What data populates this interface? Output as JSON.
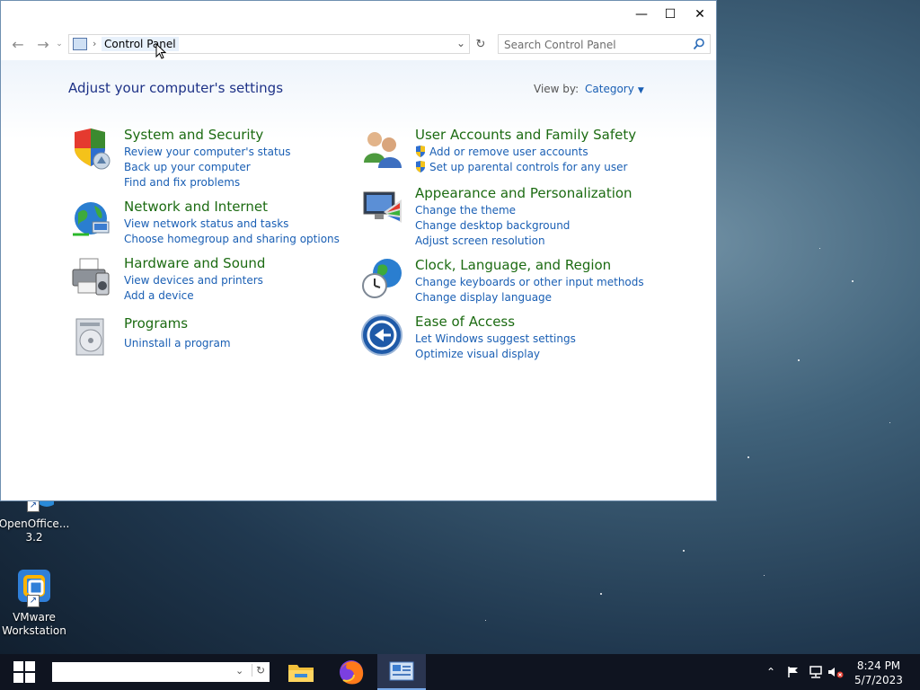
{
  "window": {
    "minimize_glyph": "—",
    "maximize_glyph": "☐",
    "close_glyph": "✕"
  },
  "address": {
    "crumb": "Control Panel",
    "separator": "›"
  },
  "search": {
    "placeholder": "Search Control Panel"
  },
  "header": {
    "title": "Adjust your computer's settings",
    "view_by_label": "View by:",
    "view_by_value": "Category"
  },
  "categories": [
    {
      "title": "System and Security",
      "icon": "shield-icon",
      "links": [
        "Review your computer's status",
        "Back up your computer",
        "Find and fix problems"
      ]
    },
    {
      "title": "Network and Internet",
      "icon": "network-globe-icon",
      "links": [
        "View network status and tasks",
        "Choose homegroup and sharing options"
      ]
    },
    {
      "title": "Hardware and Sound",
      "icon": "printer-icon",
      "links": [
        "View devices and printers",
        "Add a device"
      ]
    },
    {
      "title": "Programs",
      "icon": "programs-disc-icon",
      "links": [
        "Uninstall a program"
      ]
    },
    {
      "title": "User Accounts and Family Safety",
      "icon": "users-icon",
      "links": [
        "Add or remove user accounts",
        "Set up parental controls for any user"
      ]
    },
    {
      "title": "Appearance and Personalization",
      "icon": "monitor-palette-icon",
      "links": [
        "Change the theme",
        "Change desktop background",
        "Adjust screen resolution"
      ]
    },
    {
      "title": "Clock, Language, and Region",
      "icon": "clock-globe-icon",
      "links": [
        "Change keyboards or other input methods",
        "Change display language"
      ]
    },
    {
      "title": "Ease of Access",
      "icon": "ease-of-access-icon",
      "links": [
        "Let Windows suggest settings",
        "Optimize visual display"
      ]
    }
  ],
  "desktop_icons": [
    {
      "line1": "OpenOffice...",
      "line2": "3.2"
    },
    {
      "line1": "VMware",
      "line2": "Workstation"
    }
  ],
  "taskbar": {
    "time": "8:24 PM",
    "date": "5/7/2023",
    "search_value": ""
  },
  "colors": {
    "link": "#1a5fb4",
    "category_title": "#1c6b12",
    "heading": "#1e3287",
    "taskbar": "#0f1420"
  }
}
